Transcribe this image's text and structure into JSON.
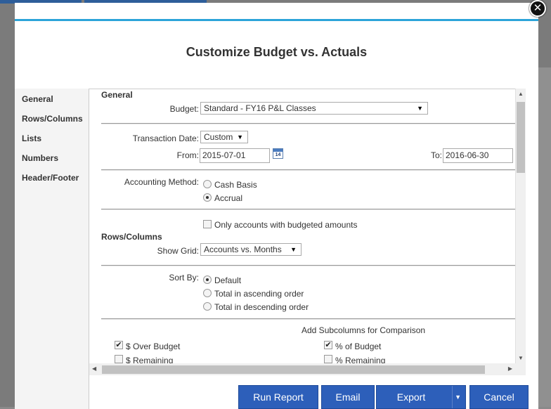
{
  "dialog": {
    "title": "Customize Budget vs. Actuals",
    "close_label": "✕"
  },
  "sidebar": {
    "items": [
      {
        "label": "General"
      },
      {
        "label": "Rows/Columns"
      },
      {
        "label": "Lists"
      },
      {
        "label": "Numbers"
      },
      {
        "label": "Header/Footer"
      }
    ]
  },
  "general": {
    "section_title": "General",
    "budget_label": "Budget:",
    "budget_value": "Standard - FY16 P&L Classes",
    "transaction_date_label": "Transaction Date:",
    "transaction_date_value": "Custom",
    "from_label": "From:",
    "from_value": "2015-07-01",
    "calendar_icon_text": "14",
    "to_label": "To:",
    "to_value": "2016-06-30",
    "accounting_method_label": "Accounting Method:",
    "accounting_options": [
      {
        "label": "Cash Basis",
        "selected": false
      },
      {
        "label": "Accrual",
        "selected": true
      }
    ]
  },
  "rows_columns": {
    "only_budgeted_label": "Only accounts with budgeted amounts",
    "only_budgeted_checked": false,
    "section_title": "Rows/Columns",
    "show_grid_label": "Show Grid:",
    "show_grid_value": "Accounts vs. Months",
    "sort_by_label": "Sort By:",
    "sort_options": [
      {
        "label": "Default",
        "selected": true
      },
      {
        "label": "Total in ascending order",
        "selected": false
      },
      {
        "label": "Total in descending order",
        "selected": false
      }
    ],
    "subcolumns_title": "Add Subcolumns for Comparison",
    "subcolumns": [
      {
        "label": "$ Over Budget",
        "checked": true
      },
      {
        "label": "% of Budget",
        "checked": true
      },
      {
        "label": "$ Remaining",
        "checked": false
      },
      {
        "label": "% Remaining",
        "checked": false
      }
    ]
  },
  "footer": {
    "run_report": "Run Report",
    "email": "Email",
    "export": "Export",
    "cancel": "Cancel"
  },
  "colors": {
    "accent": "#2ca4d9",
    "button": "#2d5fba"
  }
}
